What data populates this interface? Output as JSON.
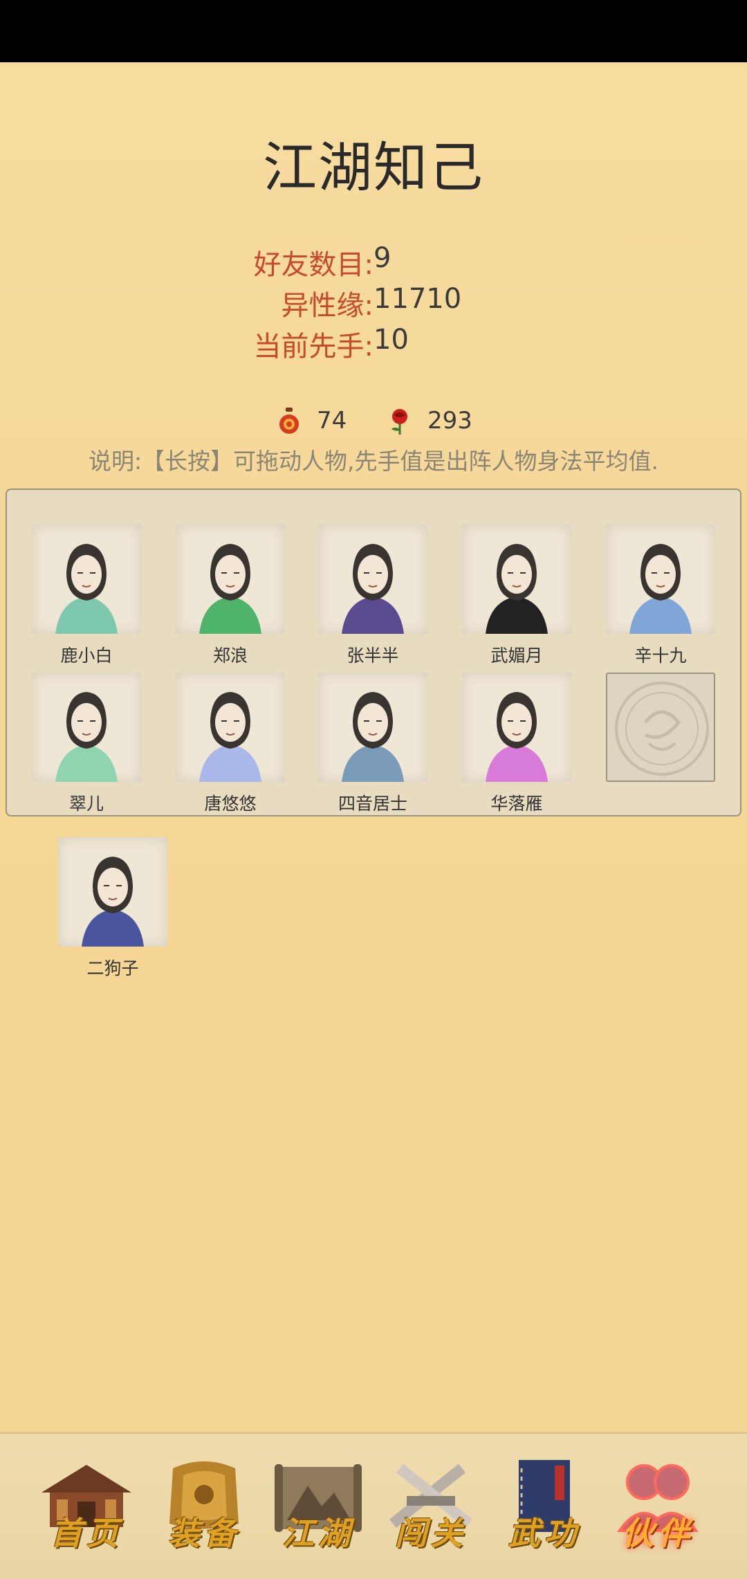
{
  "page": {
    "title": "江湖知己"
  },
  "stats": [
    {
      "label": "好友数目:",
      "value": "9"
    },
    {
      "label": "异性缘:",
      "value": "11710"
    },
    {
      "label": "当前先手:",
      "value": "10"
    }
  ],
  "resources": {
    "gourd": "74",
    "rose": "293"
  },
  "note": "说明:【长按】可拖动人物,先手值是出阵人物身法平均值.",
  "team": [
    {
      "name": "鹿小白",
      "icon": "portrait-icon",
      "color": "#7fc8b0"
    },
    {
      "name": "郑浪",
      "icon": "portrait-icon",
      "color": "#4fb36a"
    },
    {
      "name": "张半半",
      "icon": "portrait-icon",
      "color": "#5b4a8e"
    },
    {
      "name": "武媚月",
      "icon": "portrait-icon",
      "color": "#222222"
    },
    {
      "name": "辛十九",
      "icon": "portrait-icon",
      "color": "#7fa6d6"
    },
    {
      "name": "翠儿",
      "icon": "portrait-icon",
      "color": "#8fd3b0"
    },
    {
      "name": "唐悠悠",
      "icon": "portrait-icon",
      "color": "#a9b8e8"
    },
    {
      "name": "四音居士",
      "icon": "portrait-icon",
      "color": "#7b9cb8"
    },
    {
      "name": "华落雁",
      "icon": "portrait-icon",
      "color": "#d77ad8"
    }
  ],
  "bench": [
    {
      "name": "二狗子",
      "icon": "portrait-icon",
      "color": "#4a55a0"
    }
  ],
  "nav": [
    {
      "label": "首页",
      "icon": "house-icon"
    },
    {
      "label": "装备",
      "icon": "armor-icon"
    },
    {
      "label": "江湖",
      "icon": "scroll-icon"
    },
    {
      "label": "闯关",
      "icon": "swords-icon"
    },
    {
      "label": "武功",
      "icon": "book-icon"
    },
    {
      "label": "伙伴",
      "icon": "companions-icon",
      "active": true
    }
  ]
}
